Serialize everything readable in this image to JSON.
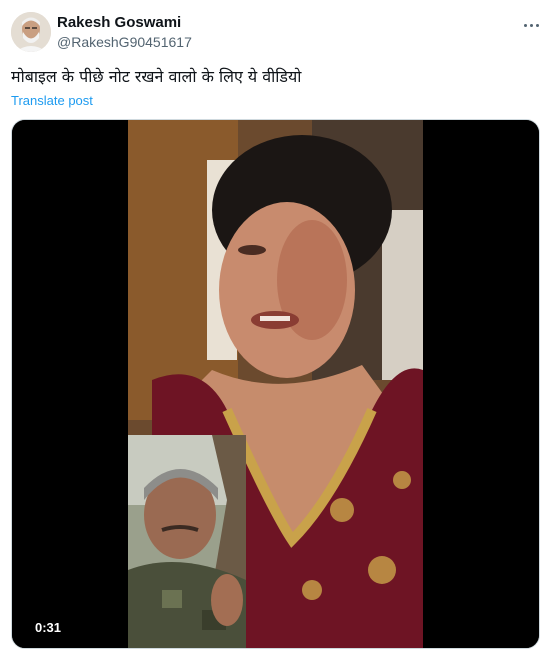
{
  "author": {
    "name": "Rakesh Goswami",
    "handle": "@RakeshG90451617",
    "avatar_icon": "person-avatar"
  },
  "tweet": {
    "text": "मोबाइल के पीछे नोट रखने वालो के लिए ये वीडियो",
    "translate_label": "Translate post"
  },
  "media": {
    "type": "video",
    "duration": "0:31",
    "description_icon": "video-thumbnail"
  },
  "menu": {
    "icon": "more-options-icon"
  },
  "colors": {
    "link": "#1d9bf0",
    "secondary_text": "#536471",
    "primary_text": "#0f1419"
  }
}
